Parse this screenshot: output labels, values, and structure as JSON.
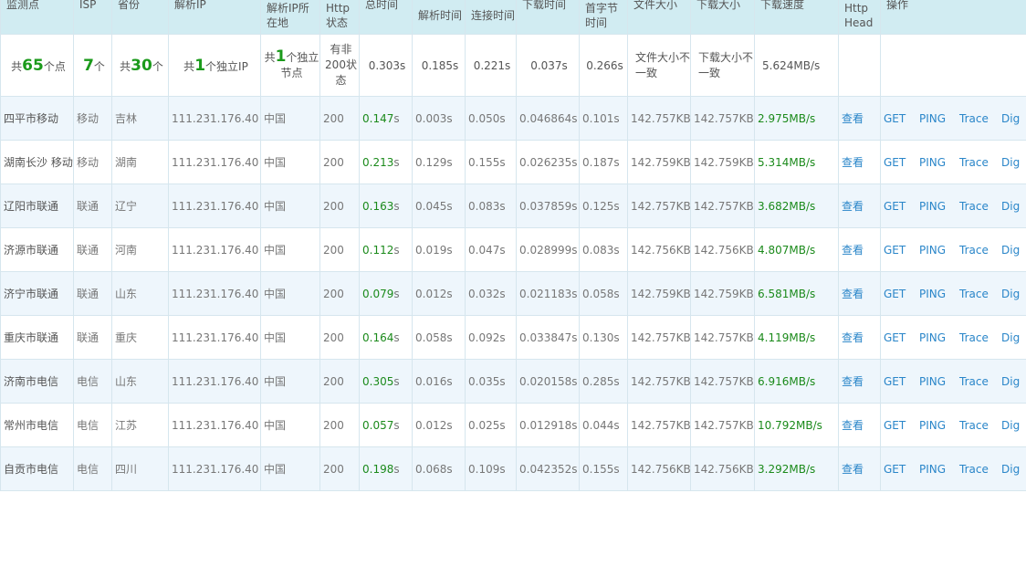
{
  "headers": {
    "node": "监测点",
    "isp": "ISP",
    "province": "省份",
    "ip": "解析IP",
    "location": "解析IP所在地",
    "http_status": "Http状态",
    "total_time": "总时间",
    "dns_time": "解析时间",
    "connect_time": "连接时间",
    "download_time": "下载时间",
    "first_byte": "首字节时间",
    "file_size": "文件大小",
    "download_size": "下载大小",
    "download_speed": "下载速度",
    "http_head": "Http Head",
    "actions": "操作"
  },
  "summary": {
    "nodes_prefix": "共",
    "nodes_count": "65",
    "nodes_suffix": "个点",
    "isp_count": "7",
    "isp_suffix": "个",
    "prov_prefix": "共",
    "prov_count": "30",
    "prov_suffix": "个",
    "ip_prefix": "共",
    "ip_count": "1",
    "ip_suffix": "个独立IP",
    "loc_prefix": "共",
    "loc_count": "1",
    "loc_suffix": "个独立节点",
    "status": "有非200状态",
    "total": "0.303s",
    "dns": "0.185s",
    "connect": "0.221s",
    "download": "0.037s",
    "first_byte": "0.266s",
    "file_size": "文件大小不一致",
    "download_size": "下载大小不一致",
    "speed": "5.624MB/s"
  },
  "actions": {
    "view": "查看",
    "get": "GET",
    "ping": "PING",
    "trace": "Trace",
    "dig": "Dig"
  },
  "unit_s": "s",
  "rows": [
    {
      "node": "四平市移动",
      "isp": "移动",
      "prov": "吉林",
      "ip": "111.231.176.40",
      "loc": "中国",
      "status": "200",
      "total": "0.147",
      "dns": "0.003s",
      "connect": "0.050s",
      "download": "0.046864s",
      "first": "0.101s",
      "file": "142.757KB",
      "dl": "142.757KB",
      "speed": "2.975MB/s"
    },
    {
      "node": "湖南长沙 移动",
      "isp": "移动",
      "prov": "湖南",
      "ip": "111.231.176.40",
      "loc": "中国",
      "status": "200",
      "total": "0.213",
      "dns": "0.129s",
      "connect": "0.155s",
      "download": "0.026235s",
      "first": "0.187s",
      "file": "142.759KB",
      "dl": "142.759KB",
      "speed": "5.314MB/s"
    },
    {
      "node": "辽阳市联通",
      "isp": "联通",
      "prov": "辽宁",
      "ip": "111.231.176.40",
      "loc": "中国",
      "status": "200",
      "total": "0.163",
      "dns": "0.045s",
      "connect": "0.083s",
      "download": "0.037859s",
      "first": "0.125s",
      "file": "142.757KB",
      "dl": "142.757KB",
      "speed": "3.682MB/s"
    },
    {
      "node": "济源市联通",
      "isp": "联通",
      "prov": "河南",
      "ip": "111.231.176.40",
      "loc": "中国",
      "status": "200",
      "total": "0.112",
      "dns": "0.019s",
      "connect": "0.047s",
      "download": "0.028999s",
      "first": "0.083s",
      "file": "142.756KB",
      "dl": "142.756KB",
      "speed": "4.807MB/s"
    },
    {
      "node": "济宁市联通",
      "isp": "联通",
      "prov": "山东",
      "ip": "111.231.176.40",
      "loc": "中国",
      "status": "200",
      "total": "0.079",
      "dns": "0.012s",
      "connect": "0.032s",
      "download": "0.021183s",
      "first": "0.058s",
      "file": "142.759KB",
      "dl": "142.759KB",
      "speed": "6.581MB/s"
    },
    {
      "node": "重庆市联通",
      "isp": "联通",
      "prov": "重庆",
      "ip": "111.231.176.40",
      "loc": "中国",
      "status": "200",
      "total": "0.164",
      "dns": "0.058s",
      "connect": "0.092s",
      "download": "0.033847s",
      "first": "0.130s",
      "file": "142.757KB",
      "dl": "142.757KB",
      "speed": "4.119MB/s"
    },
    {
      "node": "济南市电信",
      "isp": "电信",
      "prov": "山东",
      "ip": "111.231.176.40",
      "loc": "中国",
      "status": "200",
      "total": "0.305",
      "dns": "0.016s",
      "connect": "0.035s",
      "download": "0.020158s",
      "first": "0.285s",
      "file": "142.757KB",
      "dl": "142.757KB",
      "speed": "6.916MB/s"
    },
    {
      "node": "常州市电信",
      "isp": "电信",
      "prov": "江苏",
      "ip": "111.231.176.40",
      "loc": "中国",
      "status": "200",
      "total": "0.057",
      "dns": "0.012s",
      "connect": "0.025s",
      "download": "0.012918s",
      "first": "0.044s",
      "file": "142.757KB",
      "dl": "142.757KB",
      "speed": "10.792MB/s"
    },
    {
      "node": "自贡市电信",
      "isp": "电信",
      "prov": "四川",
      "ip": "111.231.176.40",
      "loc": "中国",
      "status": "200",
      "total": "0.198",
      "dns": "0.068s",
      "connect": "0.109s",
      "download": "0.042352s",
      "first": "0.155s",
      "file": "142.756KB",
      "dl": "142.756KB",
      "speed": "3.292MB/s"
    }
  ]
}
